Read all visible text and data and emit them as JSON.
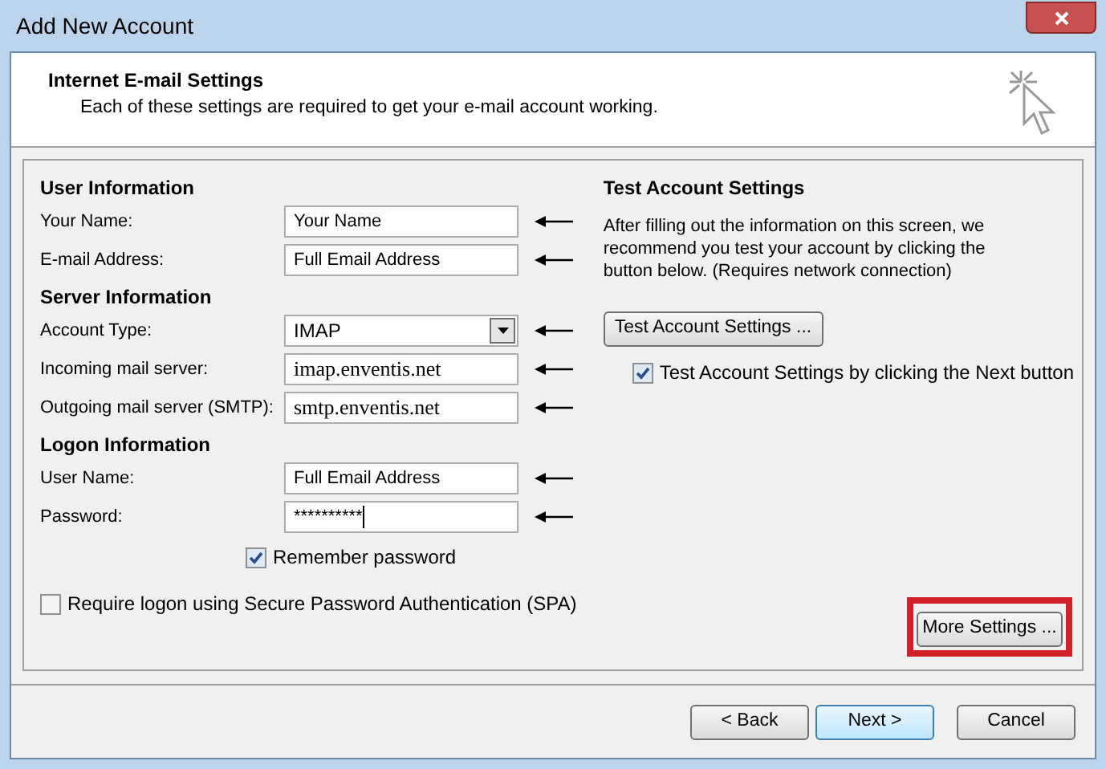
{
  "window": {
    "title": "Add New Account"
  },
  "header": {
    "title": "Internet E-mail Settings",
    "subtitle": "Each of these settings are required to get your e-mail account working."
  },
  "sections": [
    {
      "title": "User Information",
      "fields": [
        {
          "label": "Your Name:",
          "value": "Your Name",
          "kind": "text",
          "annotated": true,
          "focused": false
        },
        {
          "label": "E-mail Address:",
          "value": "Full Email Address",
          "kind": "text",
          "annotated": true,
          "focused": false
        }
      ]
    },
    {
      "title": "Server Information",
      "fields": [
        {
          "label": "Account Type:",
          "value": "IMAP",
          "kind": "select",
          "annotated": true,
          "focused": false
        },
        {
          "label": "Incoming mail server:",
          "value": "imap.enventis.net",
          "kind": "server",
          "annotated": true,
          "focused": false
        },
        {
          "label": "Outgoing mail server (SMTP):",
          "value": "smtp.enventis.net",
          "kind": "server",
          "annotated": true,
          "focused": false
        }
      ]
    },
    {
      "title": "Logon Information",
      "fields": [
        {
          "label": "User Name:",
          "value": "Full Email Address",
          "kind": "text",
          "annotated": true,
          "focused": false
        },
        {
          "label": "Password:",
          "value": "**********",
          "kind": "password",
          "annotated": true,
          "focused": true
        }
      ]
    }
  ],
  "remember_password": {
    "label": "Remember password",
    "checked": true
  },
  "require_spa": {
    "label": "Require logon using Secure Password Authentication (SPA)",
    "checked": false
  },
  "test": {
    "title": "Test Account Settings",
    "description": "After filling out the information on this screen, we recommend you test your account by clicking the button below. (Requires network connection)",
    "button": "Test Account Settings ...",
    "auto_test": {
      "label": "Test Account Settings by clicking the Next button",
      "checked": true
    }
  },
  "more_settings": {
    "label": "More Settings ...",
    "highlighted": true
  },
  "buttons": [
    {
      "label": "< Back",
      "default": false
    },
    {
      "label": "Next >",
      "default": true
    },
    {
      "label": "Cancel",
      "default": false
    }
  ]
}
